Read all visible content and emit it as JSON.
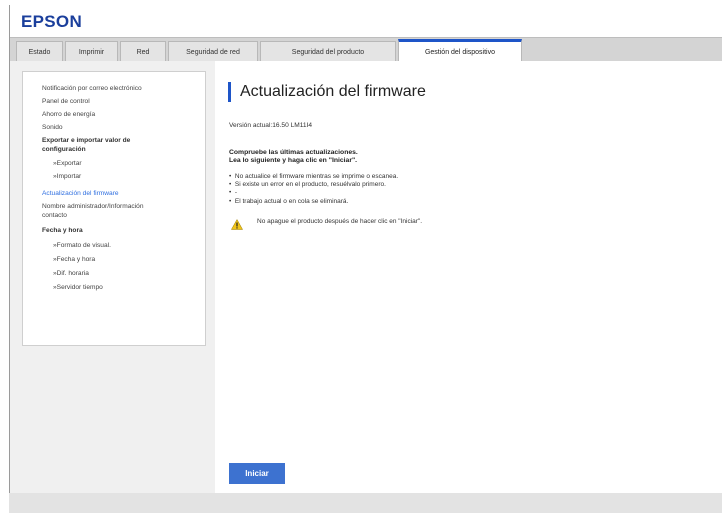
{
  "header": {
    "brand": "EPSON"
  },
  "tabs": [
    {
      "label": "Estado"
    },
    {
      "label": "Imprimir"
    },
    {
      "label": "Red"
    },
    {
      "label": "Seguridad de red"
    },
    {
      "label": "Seguridad del producto"
    },
    {
      "label": "Gestión del dispositivo",
      "active": true
    }
  ],
  "sidebar": {
    "items": [
      {
        "label": "Notificación por correo electrónico"
      },
      {
        "label": "Panel de control"
      },
      {
        "label": "Ahorro de energía"
      },
      {
        "label": "Sonido"
      },
      {
        "label": "Exportar e importar valor de"
      },
      {
        "label": "configuración"
      },
      {
        "label": "»Exportar"
      },
      {
        "label": "»Importar"
      },
      {
        "label": "Actualización del firmware",
        "selected": true
      },
      {
        "label": "Nombre administrador/Información"
      },
      {
        "label": "contacto"
      },
      {
        "label": "Fecha y hora"
      },
      {
        "label": "»Formato de visual."
      },
      {
        "label": "»Fecha y hora"
      },
      {
        "label": "»Dif. horaria"
      },
      {
        "label": "»Servidor tiempo"
      }
    ]
  },
  "main": {
    "title": "Actualización del firmware",
    "version": "Versión actual:16.50 LM11I4",
    "instruction_line1": "Compruebe las últimas actualizaciones.",
    "instruction_line2": "Lea lo siguiente y haga clic en \"Iniciar\".",
    "bullets": [
      "No actualice el firmware mientras se imprime o escanea.",
      "Si existe un error en el producto, resuélvalo primero.",
      "-",
      "El trabajo actual o en cola se eliminará."
    ],
    "warning_icon": "warning-triangle-icon",
    "warning": "No apague el producto después de hacer clic en \"Iniciar\".",
    "start_button": "Iniciar"
  },
  "colors": {
    "brand": "#1b3f9c",
    "accent": "#1e55c8",
    "link_selected": "#2f6fe0",
    "button": "#3d72d0",
    "warning": "#f0c419"
  }
}
